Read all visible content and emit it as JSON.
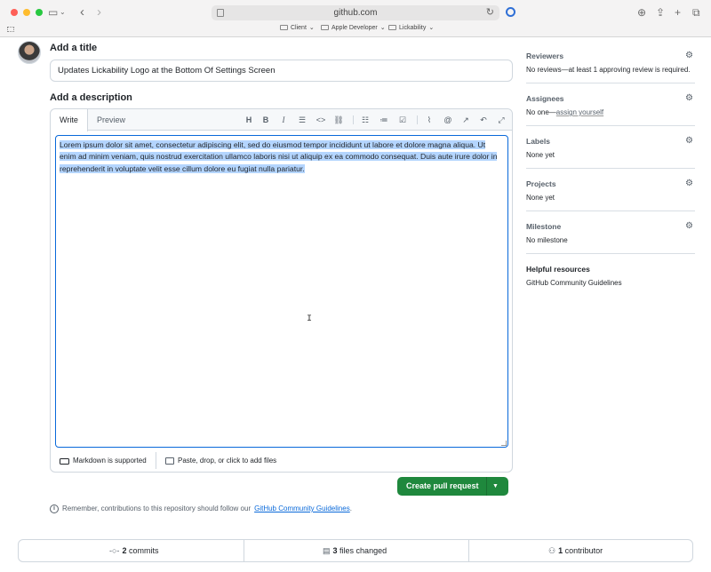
{
  "browser": {
    "url": "github.com",
    "bookmarks": [
      "Client",
      "Apple Developer",
      "Lickability"
    ],
    "icons": [
      "sidebar-icon",
      "back-icon",
      "forward-icon",
      "reload-icon",
      "download-icon",
      "share-icon",
      "new-tab-icon",
      "tabs-icon"
    ]
  },
  "form": {
    "title_heading": "Add a title",
    "title_value": "Updates Lickability Logo at the Bottom Of Settings Screen",
    "description_heading": "Add a description",
    "tabs": [
      "Write",
      "Preview"
    ],
    "toolbar_icons": [
      "heading-icon",
      "bold-icon",
      "italic-icon",
      "quote-icon",
      "code-icon",
      "link-icon",
      "ordered-list-icon",
      "unordered-list-icon",
      "task-list-icon",
      "attach-icon",
      "mention-icon",
      "reference-icon",
      "undo-icon",
      "fullscreen-icon"
    ],
    "description_text": "Lorem ipsum dolor sit amet, consectetur adipiscing elit, sed do eiusmod tempor incididunt ut labore et dolore magna aliqua. Ut enim ad minim veniam, quis nostrud exercitation ullamco laboris nisi ut aliquip ex ea commodo consequat. Duis aute irure dolor in reprehenderit in voluptate velit esse cillum dolore eu fugiat nulla pariatur.",
    "markdown_note": "Markdown is supported",
    "attach_note": "Paste, drop, or click to add files",
    "create_button": "Create pull request",
    "notice_prefix": "Remember, contributions to this repository should follow our",
    "notice_link": "GitHub Community Guidelines",
    "notice_suffix": "."
  },
  "sidebar": {
    "reviewers": {
      "heading": "Reviewers",
      "value": "No reviews—at least 1 approving review is required."
    },
    "assignees": {
      "heading": "Assignees",
      "value_prefix": "No one—",
      "value_link": "assign yourself"
    },
    "labels": {
      "heading": "Labels",
      "value": "None yet"
    },
    "projects": {
      "heading": "Projects",
      "value": "None yet"
    },
    "milestone": {
      "heading": "Milestone",
      "value": "No milestone"
    },
    "resources": {
      "heading": "Helpful resources",
      "link": "GitHub Community Guidelines"
    }
  },
  "summary": {
    "commits_count": "2",
    "commits_label": "commits",
    "files_count": "3",
    "files_label": "files changed",
    "contributors_count": "1",
    "contributors_label": "contributor"
  },
  "colors": {
    "accent": "#0969da",
    "primary_button": "#1f883d",
    "selection": "#b4d5fe"
  }
}
